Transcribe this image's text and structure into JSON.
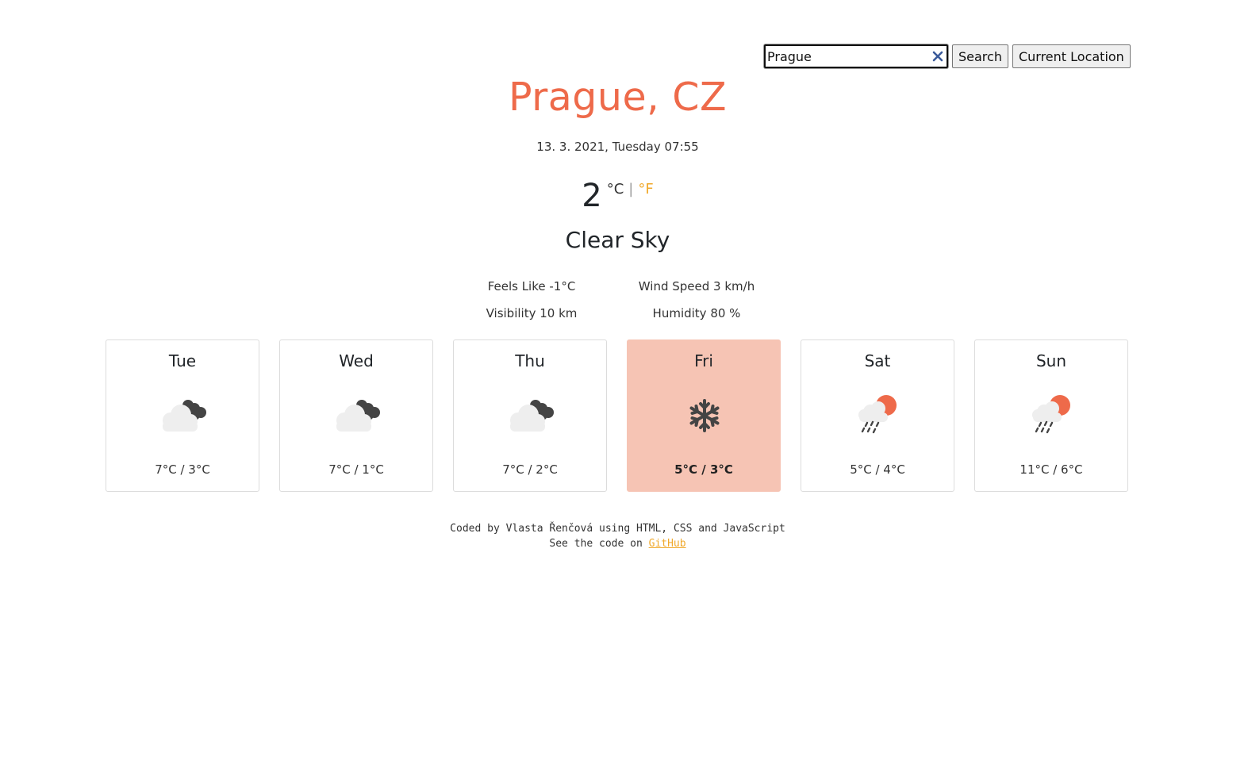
{
  "search": {
    "value": "Prague",
    "search_label": "Search",
    "location_label": "Current Location"
  },
  "current": {
    "city": "Prague, CZ",
    "datetime": "13. 3. 2021, Tuesday 07:55",
    "temperature": "2",
    "unit_c": "°C",
    "unit_sep": "|",
    "unit_f": "°F",
    "description": "Clear Sky",
    "feels_like": "Feels Like -1°C",
    "wind_speed": "Wind Speed 3 km/h",
    "visibility": "Visibility 10 km",
    "humidity": "Humidity 80 %"
  },
  "forecast": [
    {
      "day": "Tue",
      "temp": "7°C / 3°C",
      "icon": "cloudy-night-icon",
      "active": false
    },
    {
      "day": "Wed",
      "temp": "7°C / 1°C",
      "icon": "cloudy-night-icon",
      "active": false
    },
    {
      "day": "Thu",
      "temp": "7°C / 2°C",
      "icon": "cloudy-night-icon",
      "active": false
    },
    {
      "day": "Fri",
      "temp": "5°C / 3°C",
      "icon": "snowflake-icon",
      "active": true
    },
    {
      "day": "Sat",
      "temp": "5°C / 4°C",
      "icon": "sun-rain-icon",
      "active": false
    },
    {
      "day": "Sun",
      "temp": "11°C / 6°C",
      "icon": "sun-rain-icon",
      "active": false
    }
  ],
  "footer": {
    "line1": "Coded by Vlasta Řenčová using HTML, CSS and JavaScript",
    "line2_prefix": "See the code on ",
    "link_text": "GitHub"
  },
  "colors": {
    "accent": "#ee6a4a",
    "highlight": "#f6c4b4",
    "unit_link": "#f0a92c"
  }
}
